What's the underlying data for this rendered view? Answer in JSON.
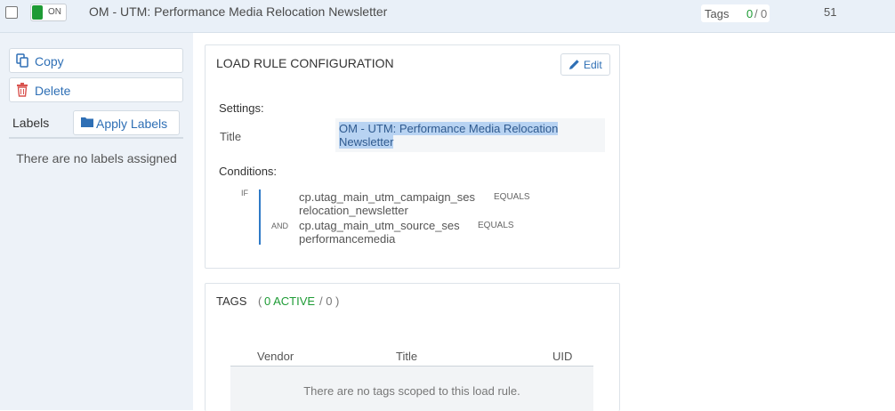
{
  "row": {
    "toggle_label": "ON",
    "title": "OM - UTM: Performance Media Relocation Newsletter",
    "tags_label": "Tags",
    "tags_active": "0",
    "tags_slash": "/",
    "tags_total": "0",
    "uid": "51"
  },
  "sidebar": {
    "copy_label": "Copy",
    "delete_label": "Delete",
    "labels_title": "Labels",
    "apply_labels": "Apply Labels",
    "no_labels": "There are no labels assigned"
  },
  "config": {
    "title": "LOAD RULE CONFIGURATION",
    "edit_label": "Edit",
    "settings_heading": "Settings:",
    "title_key": "Title",
    "title_value": "OM - UTM: Performance Media Relocation Newsletter",
    "conditions_heading": "Conditions:",
    "conditions": [
      {
        "prefix": "IF",
        "field": "cp.utag_main_utm_campaign_ses",
        "operator": "EQUALS",
        "value": "relocation_newsletter"
      },
      {
        "prefix": "AND",
        "field": "cp.utag_main_utm_source_ses",
        "operator": "EQUALS",
        "value": "performancemedia"
      }
    ]
  },
  "tags_panel": {
    "heading": "TAGS",
    "paren_open": "(",
    "active_text": "0 ACTIVE",
    "slash_total": "/ 0",
    "paren_close": ")",
    "columns": [
      "Vendor",
      "Title",
      "UID"
    ],
    "empty_message": "There are no tags scoped to this load rule."
  },
  "colors": {
    "accent_blue": "#2e6fb5",
    "active_green": "#1e9b35",
    "delete_red": "#d9534f",
    "header_bg": "#e9f0f8",
    "selection": "#b8d3f2"
  },
  "icons": {
    "copy": "copy-icon",
    "delete": "trash-icon",
    "apply_labels": "folder-icon",
    "edit": "pencil-icon"
  }
}
